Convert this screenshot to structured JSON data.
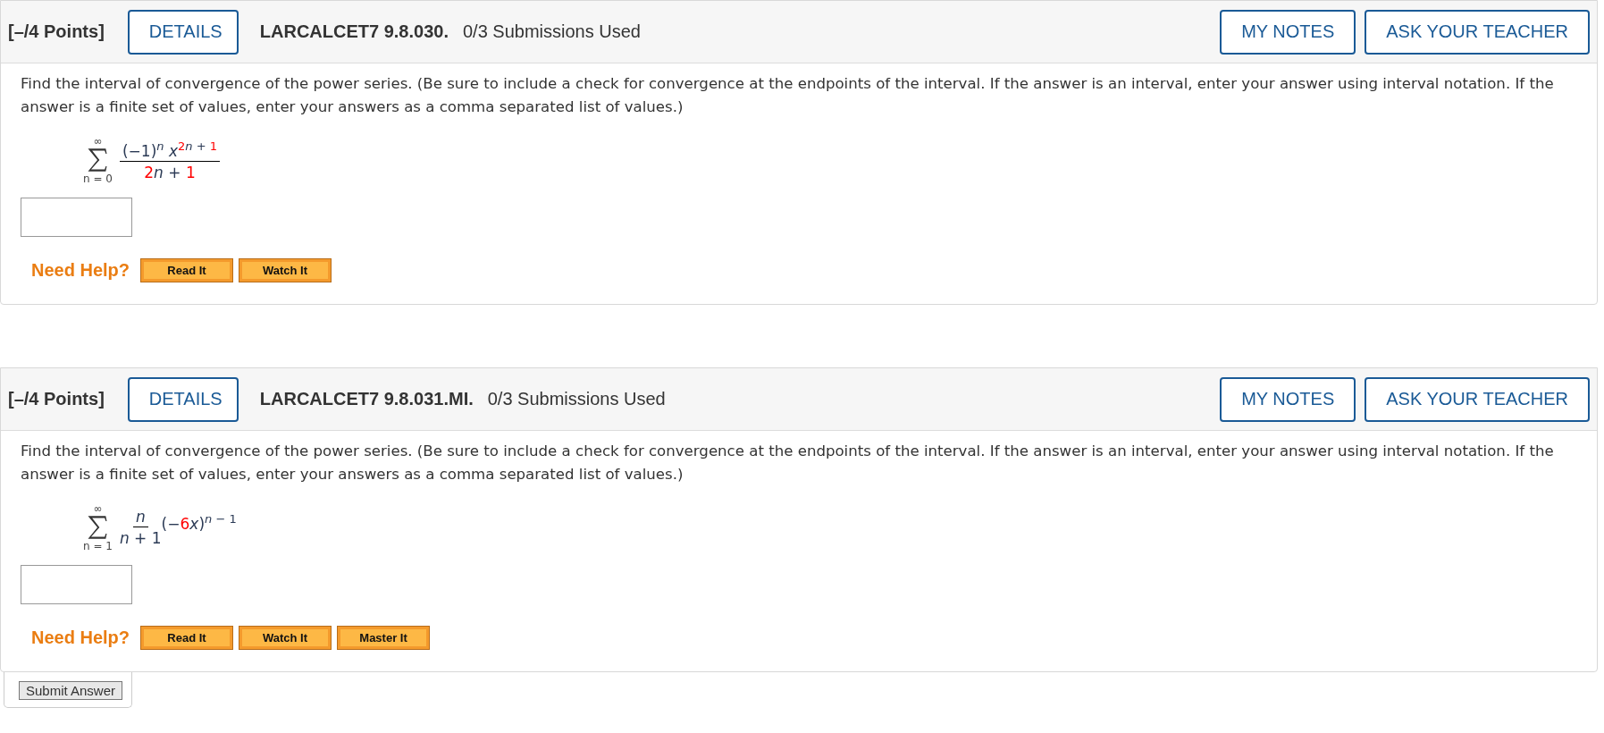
{
  "questions": [
    {
      "points": "[–/4 Points]",
      "details": "DETAILS",
      "code": "LARCALCET7 9.8.030.",
      "submissions": "0/3 Submissions Used",
      "my_notes": "MY NOTES",
      "ask_teacher": "ASK YOUR TEACHER",
      "prompt": "Find the interval of convergence of the power series. (Be sure to include a check for convergence at the endpoints of the interval. If the answer is an interval, enter your answer using interval notation. If the answer is a finite set of values, enter your answers as a comma separated list of values.)",
      "formula": {
        "upper": "∞",
        "lower": "n = 0",
        "numerator": [
          {
            "text": "(−1)"
          },
          {
            "text": "n",
            "italic": true,
            "raised": true
          },
          {
            "text": " x",
            "italic": true
          },
          {
            "text": "2",
            "raised": true,
            "color": "#ff0000"
          },
          {
            "text": "n",
            "italic": true,
            "raised": true
          },
          {
            "text": " + ",
            "raised": true
          },
          {
            "text": "1",
            "raised": true,
            "color": "#ff0000"
          }
        ],
        "denominator": [
          {
            "text": "2",
            "color": "#ff0000"
          },
          {
            "text": "n",
            "italic": true
          },
          {
            "text": " + "
          },
          {
            "text": "1",
            "color": "#ff0000"
          }
        ]
      },
      "need_help": "Need Help?",
      "help_buttons": [
        "Read It",
        "Watch It"
      ]
    },
    {
      "points": "[–/4 Points]",
      "details": "DETAILS",
      "code": "LARCALCET7 9.8.031.MI.",
      "submissions": "0/3 Submissions Used",
      "my_notes": "MY NOTES",
      "ask_teacher": "ASK YOUR TEACHER",
      "prompt": "Find the interval of convergence of the power series. (Be sure to include a check for convergence at the endpoints of the interval. If the answer is an interval, enter your answer using interval notation. If the answer is a finite set of values, enter your answers as a comma separated list of values.)",
      "formula": {
        "upper": "∞",
        "lower": "n = 1",
        "numerator": [
          {
            "text": "n",
            "italic": true
          }
        ],
        "denominator": [
          {
            "text": "n",
            "italic": true
          },
          {
            "text": " + 1"
          }
        ],
        "trailing": [
          {
            "text": "(−"
          },
          {
            "text": "6",
            "color": "#ff0000"
          },
          {
            "text": "x",
            "italic": true
          },
          {
            "text": ")"
          },
          {
            "text": "n",
            "italic": true,
            "raised": true
          },
          {
            "text": " − 1",
            "raised": true
          }
        ]
      },
      "need_help": "Need Help?",
      "help_buttons": [
        "Read It",
        "Watch It",
        "Master It"
      ]
    }
  ],
  "submit": "Submit Answer"
}
